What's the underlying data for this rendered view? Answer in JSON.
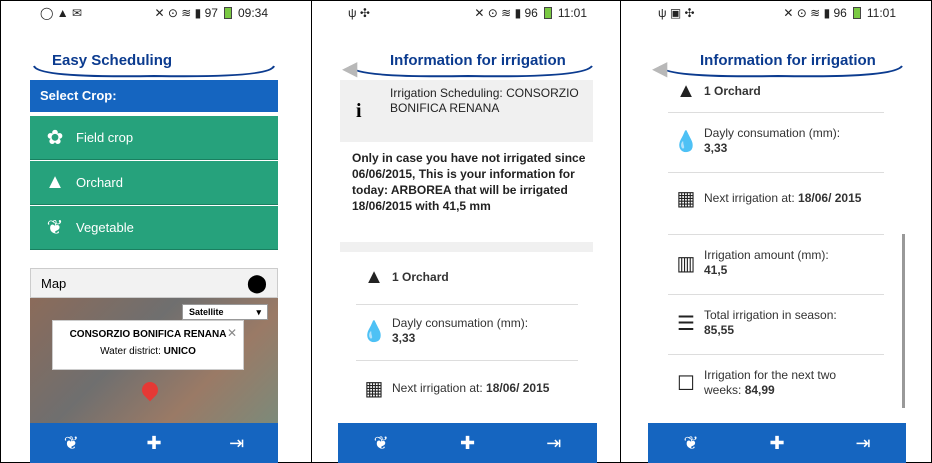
{
  "status": {
    "p1": {
      "time": "09:34",
      "left_icons": "◯ ▲ ✉",
      "right_icons": "✕ ⊙ ≋ ▮ 97"
    },
    "p2": {
      "time": "11:01",
      "left_icons": "ψ ✣",
      "right_icons": "✕ ⊙ ≋ ▮ 96"
    },
    "p3": {
      "time": "11:01",
      "left_icons": "ψ ▣ ✣",
      "right_icons": "✕ ⊙ ≋ ▮ 96"
    }
  },
  "screen1": {
    "title": "Easy Scheduling",
    "select_label": "Select Crop:",
    "crops": [
      {
        "label": "Field crop",
        "icon": "sprout-icon"
      },
      {
        "label": "Orchard",
        "icon": "tree-icon"
      },
      {
        "label": "Vegetable",
        "icon": "leaf-icon"
      }
    ],
    "map_label": "Map",
    "map_type": "Satellite",
    "popup_title": "CONSORZIO BONIFICA RENANA",
    "popup_district_label": "Water district:",
    "popup_district_value": "UNICO"
  },
  "screen2": {
    "title": "Information for irrigation",
    "header_text": "Irrigation Scheduling: CONSORZIO BONIFICA RENANA",
    "message": "Only in case you have not irrigated since 06/06/2015, This is your information for today: ARBOREA that will be irrigated 18/06/2015 with 41,5 mm",
    "orchard": "1 Orchard",
    "consumption_label": "Dayly consumation (mm):",
    "consumption_value": "3,33",
    "next_label": "Next irrigation at:",
    "next_value": "18/06/ 2015"
  },
  "screen3": {
    "title": "Information for irrigation",
    "orchard": "1 Orchard",
    "consumption_label": "Dayly consumation (mm):",
    "consumption_value": "3,33",
    "next_label": "Next irrigation at:",
    "next_value": "18/06/ 2015",
    "amount_label": "Irrigation amount (mm):",
    "amount_value": "41,5",
    "season_label": "Total irrigation in season:",
    "season_value": "85,55",
    "two_weeks_label": "Irrigation for the next two weeks:",
    "two_weeks_value": "84,99"
  },
  "colors": {
    "blue": "#1565c0",
    "green": "#26a27c",
    "title_blue": "#0b3b8f"
  }
}
